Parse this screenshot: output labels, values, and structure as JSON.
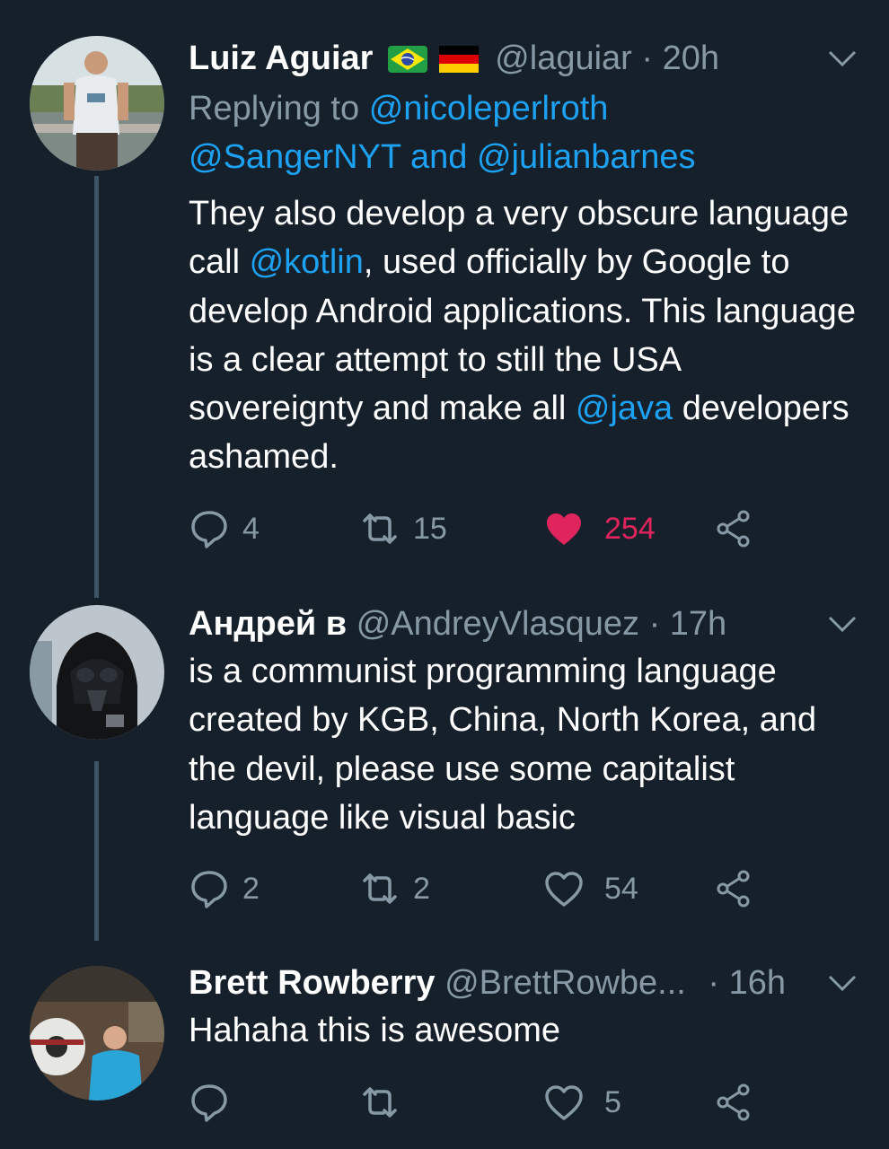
{
  "tweets": [
    {
      "name": "Luiz Aguiar",
      "flags": [
        "brazil-flag",
        "germany-flag"
      ],
      "handle": "@laguiar",
      "time": "· 20h",
      "replying_prefix": "Replying to",
      "replying_handles": [
        "@nicoleperlroth",
        "@SangerNYT",
        "@julianbarnes"
      ],
      "replying_and": "and",
      "text_parts": [
        {
          "t": "They also develop a very obscure language call "
        },
        {
          "t": "@kotlin",
          "link": true
        },
        {
          "t": ", used officially by Google to develop Android applications. This language is a clear attempt to still the USA sovereignty and make all "
        },
        {
          "t": "@java",
          "link": true
        },
        {
          "t": " developers ashamed."
        }
      ],
      "replies": "4",
      "retweets": "15",
      "likes": "254",
      "liked": true
    },
    {
      "name": "Андрей в",
      "handle": "@AndreyVlasquez",
      "time": "· 17h",
      "text": "is a communist programming language created by KGB, China, North Korea, and the devil, please use some capitalist language like visual basic",
      "replies": "2",
      "retweets": "2",
      "likes": "54",
      "liked": false
    },
    {
      "name": "Brett Rowberry",
      "handle": "@BrettRowbe...",
      "time": "· 16h",
      "text": "Hahaha this is awesome",
      "replies": "",
      "retweets": "",
      "likes": "5",
      "liked": false
    }
  ],
  "icons": {
    "reply": "reply-icon",
    "retweet": "retweet-icon",
    "like": "heart-icon",
    "share": "share-icon",
    "more": "chevron-down-icon"
  },
  "colors": {
    "background": "#15202b",
    "link": "#1da1f2",
    "muted": "#8899a6",
    "like": "#e0245e",
    "thread_line": "#3d5466"
  }
}
